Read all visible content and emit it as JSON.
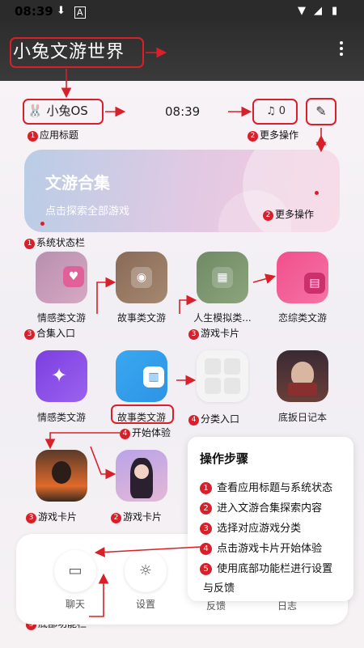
{
  "status_bar": {
    "time": "08:39"
  },
  "app_bar": {
    "title": "小兔文游世界"
  },
  "header": {
    "app_name": "小兔OS",
    "time": "08:39",
    "notif_count": "0"
  },
  "hero": {
    "title": "文游合集",
    "subtitle": "点击探索全部游戏"
  },
  "tiles": [
    {
      "label": "情感类文游"
    },
    {
      "label": "故事类文游"
    },
    {
      "label": "人生模拟类..."
    },
    {
      "label": "恋综类文游"
    },
    {
      "label": "情感类文游"
    },
    {
      "label": "故事类文游"
    },
    {
      "label": ""
    },
    {
      "label": "底扳日记本"
    }
  ],
  "annotations": {
    "a1": "应用标题",
    "a2": "更多操作",
    "a3": "更多操作",
    "a4": "系统状态栏",
    "a5": "合集入口",
    "a6": "游戏卡片",
    "a7": "开始体验",
    "a8": "分类入口",
    "a9": "游戏卡片",
    "a10": "游戏卡片",
    "a11": "底部功能栏"
  },
  "badges": {
    "a1": "1",
    "a2": "2",
    "a3": "2",
    "a4": "1",
    "a5": "3",
    "a6": "3",
    "a7": "4",
    "a8": "4",
    "a9": "3",
    "a10": "2",
    "a11": "3"
  },
  "steps": {
    "title": "操作步骤",
    "items": [
      {
        "num": "1",
        "text": "查看应用标题与系统状态"
      },
      {
        "num": "2",
        "text": "进入文游合集探索内容"
      },
      {
        "num": "3",
        "text": "选择对应游戏分类"
      },
      {
        "num": "4",
        "text": "点击游戏卡片开始体验"
      },
      {
        "num": "5",
        "text": "使用底部功能栏进行设置"
      }
    ],
    "wrap": "与反馈"
  },
  "bottom_nav": [
    {
      "label": "聊天"
    },
    {
      "label": "设置"
    },
    {
      "label": "反馈"
    },
    {
      "label": "日志"
    }
  ],
  "colors": {
    "annotation_red": "#d9202a",
    "app_bar": "#2d2d2d"
  }
}
